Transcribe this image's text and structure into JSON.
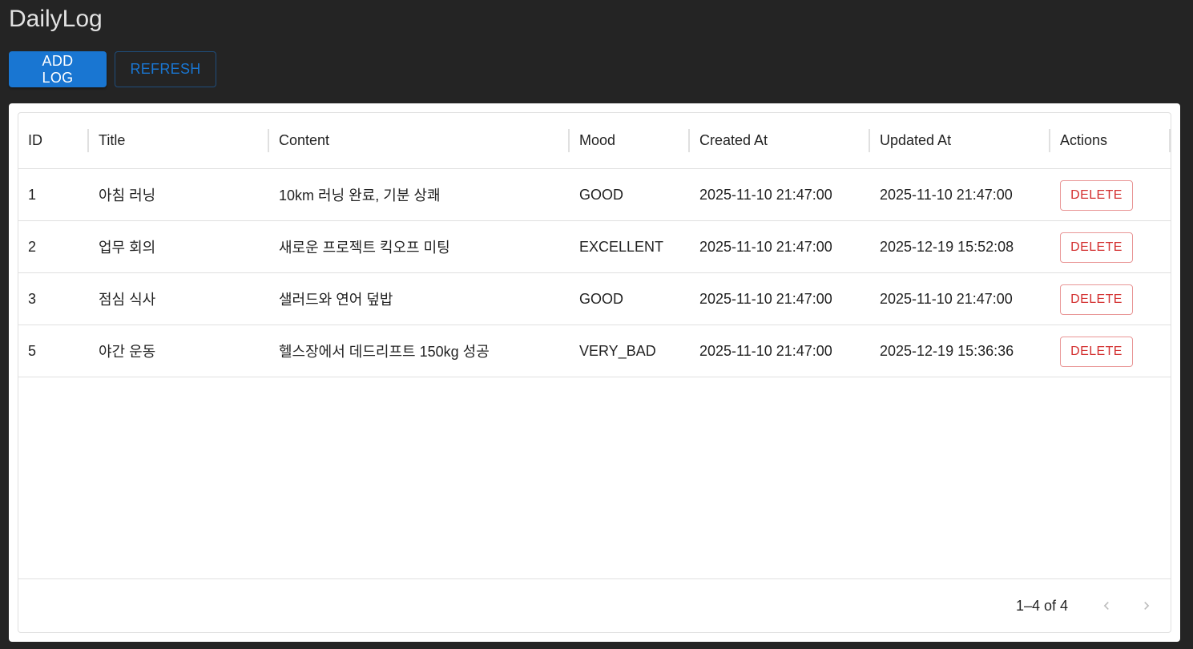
{
  "app": {
    "title": "DailyLog"
  },
  "toolbar": {
    "add_label": "ADD LOG",
    "refresh_label": "REFRESH"
  },
  "colors": {
    "background": "#242424",
    "primary": "#1976d2",
    "error": "#d32f2f"
  },
  "table": {
    "columns": [
      "ID",
      "Title",
      "Content",
      "Mood",
      "Created At",
      "Updated At",
      "Actions"
    ],
    "rows": [
      {
        "id": "1",
        "title": "아침 러닝",
        "content": "10km 러닝 완료, 기분 상쾌",
        "mood": "GOOD",
        "created_at": "2025-11-10 21:47:00",
        "updated_at": "2025-11-10 21:47:00",
        "action": "DELETE"
      },
      {
        "id": "2",
        "title": "업무 회의",
        "content": "새로운 프로젝트 킥오프 미팅",
        "mood": "EXCELLENT",
        "created_at": "2025-11-10 21:47:00",
        "updated_at": "2025-12-19 15:52:08",
        "action": "DELETE"
      },
      {
        "id": "3",
        "title": "점심 식사",
        "content": "샐러드와 연어 덮밥",
        "mood": "GOOD",
        "created_at": "2025-11-10 21:47:00",
        "updated_at": "2025-11-10 21:47:00",
        "action": "DELETE"
      },
      {
        "id": "5",
        "title": "야간 운동",
        "content": "헬스장에서 데드리프트 150kg 성공",
        "mood": "VERY_BAD",
        "created_at": "2025-11-10 21:47:00",
        "updated_at": "2025-12-19 15:36:36",
        "action": "DELETE"
      }
    ]
  },
  "pagination": {
    "range_text": "1–4 of 4",
    "prev_icon": "chevron-left-icon",
    "next_icon": "chevron-right-icon"
  }
}
